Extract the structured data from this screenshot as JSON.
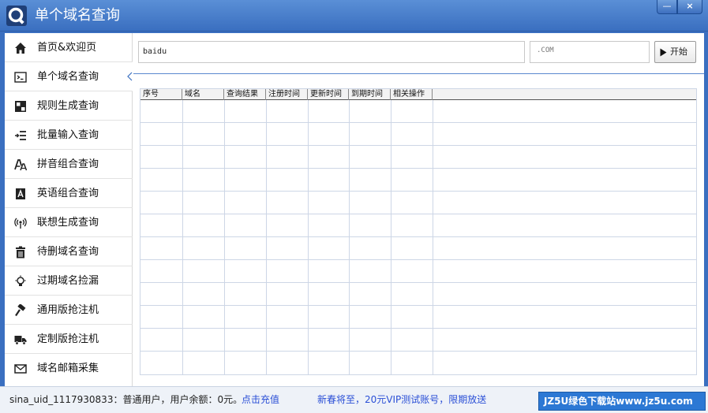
{
  "window": {
    "title": "单个域名查询",
    "minimize_icon": "minimize-icon",
    "close_icon": "close-icon",
    "minimize_glyph": "—",
    "close_glyph": "×"
  },
  "sidebar": {
    "items": [
      {
        "label": "首页&欢迎页",
        "icon": "home-icon",
        "active": false
      },
      {
        "label": "单个域名查询",
        "icon": "terminal-icon",
        "active": true
      },
      {
        "label": "规则生成查询",
        "icon": "grid-icon",
        "active": false
      },
      {
        "label": "批量输入查询",
        "icon": "list-input-icon",
        "active": false
      },
      {
        "label": "拼音组合查询",
        "icon": "font-icon",
        "active": false
      },
      {
        "label": "英语组合查询",
        "icon": "letter-a-icon",
        "active": false
      },
      {
        "label": "联想生成查询",
        "icon": "broadcast-icon",
        "active": false
      },
      {
        "label": "待删域名查询",
        "icon": "trash-icon",
        "active": false
      },
      {
        "label": "过期域名捡漏",
        "icon": "lightbulb-icon",
        "active": false
      },
      {
        "label": "通用版抢注机",
        "icon": "hammer-icon",
        "active": false
      },
      {
        "label": "定制版抢注机",
        "icon": "truck-icon",
        "active": false
      },
      {
        "label": "域名邮箱采集",
        "icon": "envelope-icon",
        "active": false
      }
    ]
  },
  "toolbar": {
    "domain_value": "baidu",
    "suffix_value": ".COM",
    "start_label": "开始"
  },
  "table": {
    "columns": [
      "序号",
      "域名",
      "查询结果",
      "注册时间",
      "更新时间",
      "到期时间",
      "相关操作"
    ],
    "rows": []
  },
  "statusbar": {
    "user_info": "sina_uid_1117930833：普通用户，用户余额：0元。",
    "recharge_link": "点击充值",
    "promo": "新春将至，20元VIP测试账号，限期放送",
    "watermark": "JZ5U绿色下载站www.jz5u.com"
  },
  "colors": {
    "titlebar": "#3a6fc0",
    "link": "#2a4fd6",
    "table_grid": "#cdd6e6"
  }
}
